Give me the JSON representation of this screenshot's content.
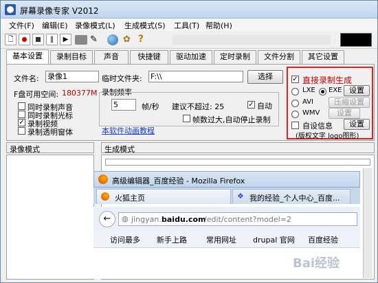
{
  "window": {
    "title": "屏幕录像专家 V2012"
  },
  "menu": [
    "文件(F)",
    "编辑(E)",
    "录像模式(L)",
    "生成模式(S)",
    "工具(T)",
    "帮助(H)"
  ],
  "tabs": [
    "基本设置",
    "录制目标",
    "声音",
    "快捷键",
    "驱动加速",
    "定时录制",
    "文件分割",
    "其它设置"
  ],
  "basic": {
    "filename_label": "文件名:",
    "filename_value": "录像1",
    "tempfolder_label": "临时文件夹:",
    "tempfolder_value": "F:\\\\",
    "choose_button": "选择",
    "free_space_label": "F盘可用空间:",
    "free_space_value": "180377M",
    "options": [
      {
        "label": "同时录制声音",
        "checked": false
      },
      {
        "label": "同时录制光标",
        "checked": false
      },
      {
        "label": "录制视频",
        "checked": true
      },
      {
        "label": "录制透明窗体",
        "checked": false
      }
    ],
    "framerate_group": "录制频率",
    "framerate_value": "5",
    "framerate_unit": "帧/秒",
    "suggest_text": "建议不超过: 25",
    "auto_label": "自动",
    "auto_checked": true,
    "stop_text": "帧数过大,自动停止录制",
    "stop_checked": false,
    "tutorial_link": "本软件动画教程"
  },
  "generate": {
    "direct_label": "直接录制生成",
    "direct_checked": true,
    "lxe_label": "LXE",
    "exe_label": "EXE",
    "setup_1": "设置",
    "avi_label": "AVI",
    "compress_setup": "压缩设置",
    "wmv_label": "WMV",
    "setup_2": "设置",
    "custom_info_label": "自设信息",
    "setup_3": "设置",
    "copyright_text": "(版权文字 logo图形)",
    "highlight_color": "#e02020"
  },
  "status": {
    "record_mode": "录像模式",
    "generate_mode": "生成模式"
  },
  "firefox": {
    "title": "高级编辑器_百度经验 - Mozilla Firefox",
    "tab1": "火狐主页",
    "tab2": "我的经验_个人中心_百度...",
    "url_gray": "jingyan.",
    "url_bold": "baidu.com",
    "url_rest": "/edit/content?model=2",
    "bookmarks": [
      "访问最多",
      "新手上路",
      "常用网址",
      "drupal 官网",
      "百度经验"
    ],
    "watermark": "Bai经验"
  }
}
